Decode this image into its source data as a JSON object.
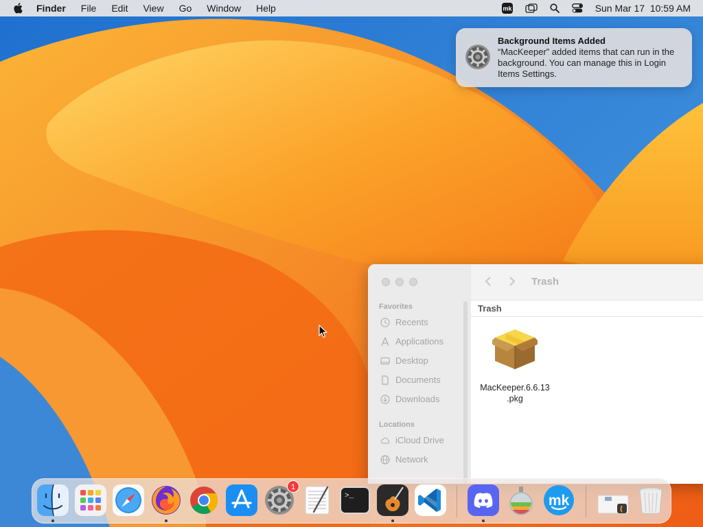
{
  "menubar": {
    "app_name": "Finder",
    "menus": [
      "File",
      "Edit",
      "View",
      "Go",
      "Window",
      "Help"
    ],
    "status_icons": [
      "mackeeper-menu-icon",
      "screen-mirroring-icon",
      "spotlight-search-icon",
      "control-center-icon"
    ],
    "clock": "Sun Mar 17  10:59 AM"
  },
  "notification": {
    "title": "Background Items Added",
    "body": "“MacKeeper” added items that can run in the background. You can manage this in Login Items Settings.",
    "icon": "system-settings-gear-icon"
  },
  "finder": {
    "window_title": "Trash",
    "path_label": "Trash",
    "sidebar": {
      "favorites_header": "Favorites",
      "favorites": [
        {
          "label": "Recents",
          "icon": "clock-icon"
        },
        {
          "label": "Applications",
          "icon": "applications-icon"
        },
        {
          "label": "Desktop",
          "icon": "desktop-icon"
        },
        {
          "label": "Documents",
          "icon": "document-icon"
        },
        {
          "label": "Downloads",
          "icon": "download-icon"
        }
      ],
      "locations_header": "Locations",
      "locations": [
        {
          "label": "iCloud Drive",
          "icon": "cloud-icon"
        },
        {
          "label": "Network",
          "icon": "globe-icon"
        }
      ]
    },
    "files": [
      {
        "name": "MacKeeper.6.6.13\n.pkg",
        "icon": "package-icon"
      }
    ]
  },
  "dock": {
    "apps": [
      {
        "name": "Finder",
        "icon": "finder-icon",
        "running": true
      },
      {
        "name": "Launchpad",
        "icon": "launchpad-icon",
        "running": false
      },
      {
        "name": "Safari",
        "icon": "safari-icon",
        "running": false
      },
      {
        "name": "Firefox",
        "icon": "firefox-icon",
        "running": true
      },
      {
        "name": "Chrome",
        "icon": "chrome-icon",
        "running": false
      },
      {
        "name": "App Store",
        "icon": "app-store-icon",
        "running": false
      },
      {
        "name": "System Settings",
        "icon": "system-settings-icon",
        "running": false,
        "badge": "1"
      },
      {
        "name": "TextEdit",
        "icon": "textedit-icon",
        "running": false
      },
      {
        "name": "Terminal",
        "icon": "terminal-icon",
        "running": false
      },
      {
        "name": "GarageBand",
        "icon": "garageband-icon",
        "running": true
      },
      {
        "name": "VS Code",
        "icon": "vscode-icon",
        "running": false
      },
      {
        "name": "Discord",
        "icon": "discord-icon",
        "running": true
      },
      {
        "name": "Installer",
        "icon": "installer-icon",
        "running": false
      },
      {
        "name": "MacKeeper",
        "icon": "mackeeper-icon",
        "running": false
      },
      {
        "name": "Downloads Stack",
        "icon": "downloads-stack-icon",
        "running": false
      },
      {
        "name": "Trash",
        "icon": "trash-icon",
        "running": false
      }
    ],
    "terminal_prompt": ">_"
  }
}
